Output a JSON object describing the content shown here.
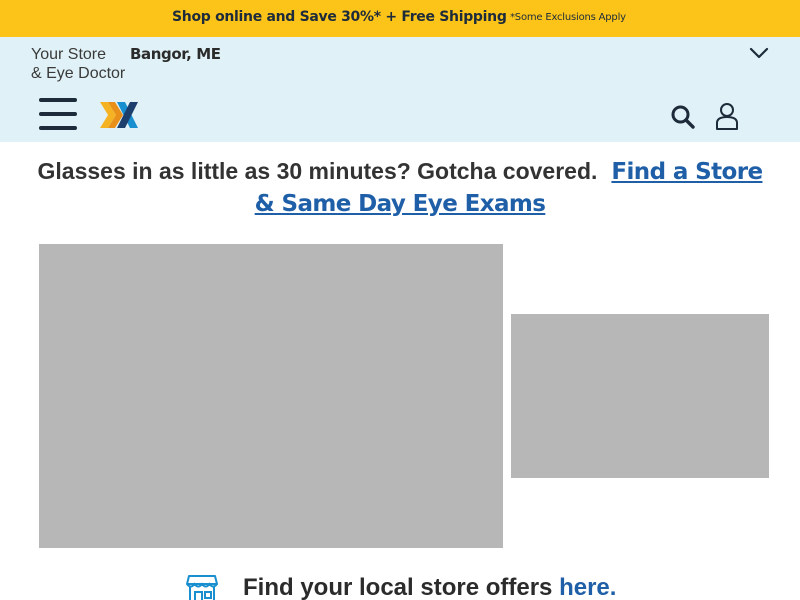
{
  "promo": {
    "text": "Shop online and Save 30%* + Free Shipping",
    "note": "*Some Exclusions Apply"
  },
  "header": {
    "store_label_line1": "Your Store",
    "store_label_line2": "& Eye Doctor",
    "store_city": "Bangor, ME"
  },
  "hero": {
    "headline": "Glasses in as little as 30 minutes? Gotcha covered.",
    "link": "Find a Store & Same Day Eye Exams"
  },
  "offers": {
    "text": "Find your local store offers",
    "link": "here."
  },
  "colors": {
    "promo_bg": "#fcc419",
    "header_bg": "#e0f2f7",
    "link": "#1f5fa8",
    "placeholder": "#b7b7b7",
    "logo_yellow": "#f5b324",
    "logo_blue": "#1a8fd0"
  },
  "icons": [
    "chevron-down-icon",
    "menu-icon",
    "logo-icon",
    "search-icon",
    "account-icon",
    "store-icon"
  ]
}
